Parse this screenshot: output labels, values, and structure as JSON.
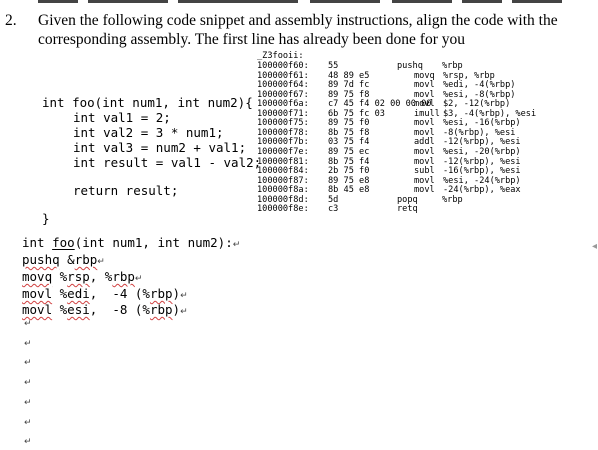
{
  "question": {
    "number": "2.",
    "line1": "Given the following code snippet and assembly instructions, align the code with the",
    "line2": "corresponding assembly. The first line has already been done for you"
  },
  "function_label": "_Z3fooii:",
  "c_code": {
    "sig": "int foo(int num1, int num2){",
    "val1": "int val1 = 2;",
    "val2": "int val2 = 3 * num1;",
    "val3": "int val3 = num2 + val1;",
    "result": "int result = val1 - val2;",
    "ret": "return result;",
    "close": "}"
  },
  "assembly": [
    {
      "addr": "100000f60:",
      "bytes": "55",
      "op": "pushq",
      "args": "%rbp"
    },
    {
      "addr": "100000f61:",
      "bytes": "48 89 e5",
      "op": "movq",
      "args": "%rsp, %rbp"
    },
    {
      "addr": "100000f64:",
      "bytes": "89 7d fc",
      "op": "movl",
      "args": "%edi, -4(%rbp)"
    },
    {
      "addr": "100000f67:",
      "bytes": "89 75 f8",
      "op": "movl",
      "args": "%esi, -8(%rbp)"
    },
    {
      "addr": "100000f6a:",
      "bytes": "c7 45 f4 02 00 00 00",
      "op": "movl",
      "args": "$2, -12(%rbp)"
    },
    {
      "addr": "100000f71:",
      "bytes": "6b 75 fc 03",
      "op": "imull",
      "args": "$3, -4(%rbp), %esi"
    },
    {
      "addr": "100000f75:",
      "bytes": "89 75 f0",
      "op": "movl",
      "args": "%esi, -16(%rbp)"
    },
    {
      "addr": "100000f78:",
      "bytes": "8b 75 f8",
      "op": "movl",
      "args": "-8(%rbp), %esi"
    },
    {
      "addr": "100000f7b:",
      "bytes": "03 75 f4",
      "op": "addl",
      "args": "-12(%rbp), %esi"
    },
    {
      "addr": "100000f7e:",
      "bytes": "89 75 ec",
      "op": "movl",
      "args": "%esi, -20(%rbp)"
    },
    {
      "addr": "100000f81:",
      "bytes": "8b 75 f4",
      "op": "movl",
      "args": "-12(%rbp), %esi"
    },
    {
      "addr": "100000f84:",
      "bytes": "2b 75 f0",
      "op": "subl",
      "args": "-16(%rbp), %esi"
    },
    {
      "addr": "100000f87:",
      "bytes": "89 75 e8",
      "op": "movl",
      "args": "%esi, -24(%rbp)"
    },
    {
      "addr": "100000f8a:",
      "bytes": "8b 45 e8",
      "op": "movl",
      "args": "-24(%rbp), %eax"
    },
    {
      "addr": "100000f8d:",
      "bytes": "5d",
      "op": "popq",
      "args": "%rbp"
    },
    {
      "addr": "100000f8e:",
      "bytes": "c3",
      "op": "retq",
      "args": ""
    }
  ],
  "editor": {
    "line1_a": "int ",
    "line1_foo": "foo",
    "line1_b": "(int num1, int num2):",
    "line2_op": "pushq",
    "line2_rest": " &",
    "line2_reg": "rbp",
    "line3_op": "movq",
    "line3_rest": " %",
    "line3_r1": "rsp",
    "line3_mid": ", %",
    "line3_r2": "rbp",
    "line4_op": "movl",
    "line4_rest": " %",
    "line4_r1": "edi",
    "line4_mid": ",  -4 (%",
    "line4_r2": "rbp",
    "line4_end": ")",
    "line5_op": "movl",
    "line5_rest": " %",
    "line5_r1": "esi",
    "line5_mid": ",  -8 (%",
    "line5_r2": "rbp",
    "line5_end": ")",
    "paragraph_mark": "↵",
    "empty_mark": "↵"
  }
}
